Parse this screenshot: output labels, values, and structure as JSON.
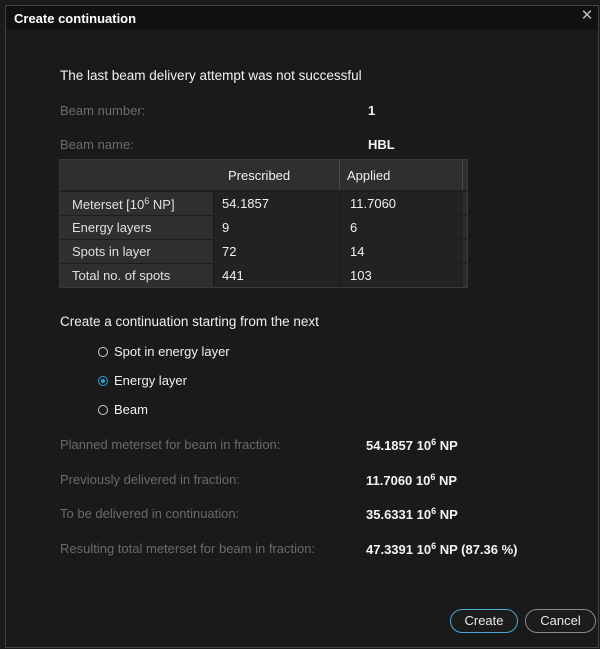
{
  "dialog": {
    "title": "Create continuation",
    "close_icon": "close-icon"
  },
  "heading": "The last beam delivery attempt was not successful",
  "beam_info": {
    "number_label": "Beam number:",
    "number_value": "1",
    "name_label": "Beam name:",
    "name_value": "HBL"
  },
  "table": {
    "headers": [
      "",
      "Prescribed",
      "Applied"
    ],
    "rows": [
      {
        "label_main": "Meterset [10",
        "label_sup": "6",
        "label_tail": " NP]",
        "prescribed": "54.1857",
        "applied": "11.7060"
      },
      {
        "label_main": "Energy layers",
        "label_sup": "",
        "label_tail": "",
        "prescribed": "9",
        "applied": "6"
      },
      {
        "label_main": "Spots in layer",
        "label_sup": "",
        "label_tail": "",
        "prescribed": "72",
        "applied": "14"
      },
      {
        "label_main": "Total no. of spots",
        "label_sup": "",
        "label_tail": "",
        "prescribed": "441",
        "applied": "103"
      }
    ]
  },
  "continuation": {
    "label": "Create a continuation starting from the next",
    "options": [
      {
        "label": "Spot in energy layer",
        "selected": false
      },
      {
        "label": "Energy layer",
        "selected": true
      },
      {
        "label": "Beam",
        "selected": false
      }
    ]
  },
  "summary": [
    {
      "label": "Planned meterset for beam in fraction:",
      "value": "54.1857",
      "unit_base": " 10",
      "unit_sup": "6",
      "unit_tail": " NP"
    },
    {
      "label": "Previously delivered in fraction:",
      "value": "11.7060",
      "unit_base": " 10",
      "unit_sup": "6",
      "unit_tail": " NP"
    },
    {
      "label": "To be delivered in continuation:",
      "value": "35.6331",
      "unit_base": " 10",
      "unit_sup": "6",
      "unit_tail": " NP"
    },
    {
      "label": "Resulting total meterset for beam in fraction:",
      "value": "47.3391",
      "unit_base": " 10",
      "unit_sup": "6",
      "unit_tail": " NP (87.36 %)"
    }
  ],
  "buttons": {
    "create": "Create",
    "cancel": "Cancel"
  },
  "colors": {
    "accent": "#2aa0d6",
    "background": "#1a1a1a",
    "table_header": "#2f2f2f"
  }
}
